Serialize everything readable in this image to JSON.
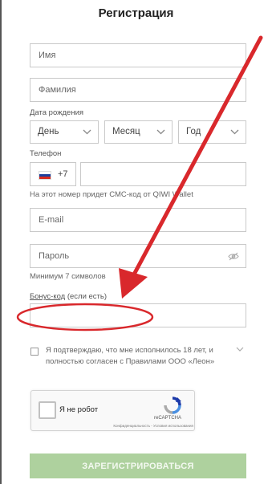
{
  "header": {
    "title": "Регистрация"
  },
  "form": {
    "name_placeholder": "Имя",
    "surname_placeholder": "Фамилия",
    "birthdate_label": "Дата рождения",
    "day_select": "День",
    "month_select": "Месяц",
    "year_select": "Год",
    "phone_label": "Телефон",
    "phone_code": "+7",
    "phone_hint": "На этот номер придет СМС-код от QIWI Wallet",
    "email_placeholder": "E-mail",
    "password_placeholder": "Пароль",
    "password_hint": "Минимум 7 символов",
    "bonus_label": "Бонус-код",
    "bonus_label_suffix": " (если есть)",
    "agreement_text": "Я подтверждаю, что мне исполнилось 18 лет, и полностью согласен с Правилами ООО «Леон»",
    "submit_label": "ЗАРЕГИСТРИРОВАТЬСЯ"
  },
  "recaptcha": {
    "label": "Я не робот",
    "brand": "reCAPTCHA",
    "links": "Конфиденциальность - Условия использования"
  },
  "colors": {
    "submit_bg": "#aed19e",
    "annotation_red": "#d9282c",
    "border": "#c9c9c9"
  },
  "icons": {
    "flag": "russia-flag-icon",
    "password_toggle": "eye-off-icon",
    "select": "chevron-down-icon"
  }
}
